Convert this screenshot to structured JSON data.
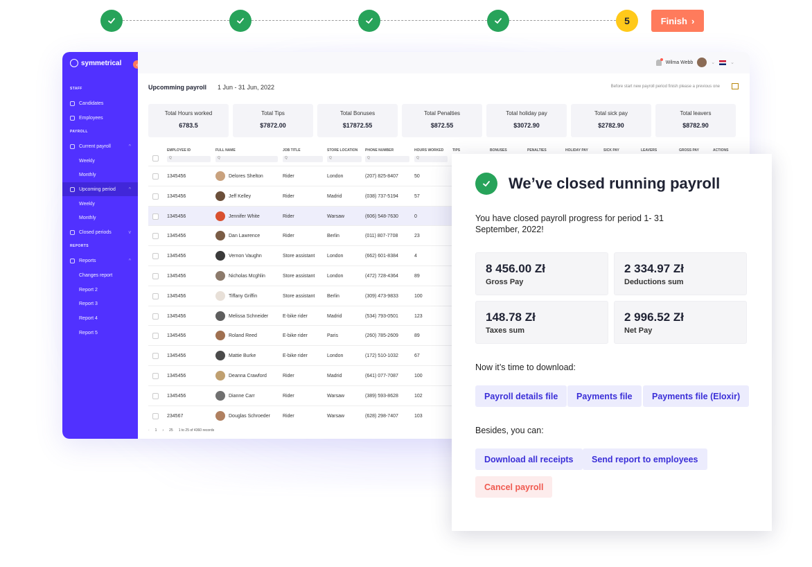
{
  "stepper": {
    "current_step": "5",
    "finish_label": "Finish",
    "done_color": "#27a35a",
    "current_color": "#ffc91a",
    "finish_color": "#ff7b5c"
  },
  "sidebar": {
    "brand": "symmetrical",
    "accent": "#5131ff",
    "sections": {
      "staff": "STAFF",
      "payroll": "PAYROLL",
      "reports": "REPORTS"
    },
    "items": {
      "candidates": "Candidates",
      "employees": "Employees",
      "current_payroll": "Current payroll",
      "current_weekly": "Weekly",
      "current_monthly": "Monthly",
      "upcoming_period": "Upcoming period",
      "upcoming_weekly": "Weekly",
      "upcoming_monthly": "Monthly",
      "closed_periods": "Closed periods",
      "reports": "Reports",
      "changes_report": "Changes report",
      "report2": "Report 2",
      "report3": "Report 3",
      "report4": "Report 4",
      "report5": "Report 5"
    }
  },
  "topbar": {
    "user_name": "Wilma Webb"
  },
  "period": {
    "title": "Upcomming payroll",
    "range": "1 Jun - 31 Jun, 2022",
    "note": "Before start new payroll period finish please a previous one"
  },
  "summary": [
    {
      "label": "Total Hours worked",
      "value": "6783.5"
    },
    {
      "label": "Total Tips",
      "value": "$7872.00"
    },
    {
      "label": "Total Bonuses",
      "value": "$17872.55"
    },
    {
      "label": "Total Penalties",
      "value": "$872.55"
    },
    {
      "label": "Total holiday pay",
      "value": "$3072.90"
    },
    {
      "label": "Total sick pay",
      "value": "$2782.90"
    },
    {
      "label": "Total leavers",
      "value": "$8782.90"
    }
  ],
  "table": {
    "headers": {
      "employee_id": "EMPLOYEE ID",
      "full_name": "FULL NAME",
      "job_title": "JOB TITLE",
      "store_location": "STORE LOCATION",
      "phone": "PHONE NUMBER",
      "hours": "HOURS WORKED",
      "tips": "TIPS",
      "bonuses": "BONUSES",
      "penalties": "PENALTIES",
      "holiday": "HOLIDAY PAY",
      "sick": "SICK PAY",
      "leavers": "LEAVERS",
      "gross": "GROSS PAY",
      "actions": "ACTIONS"
    },
    "filter_placeholder": "Q",
    "rows": [
      {
        "id": "1345456",
        "name": "Delores Shelton",
        "job": "Rider",
        "store": "London",
        "phone": "(207) 825-8407",
        "hours": "50"
      },
      {
        "id": "1345456",
        "name": "Jeff Kelley",
        "job": "Rider",
        "store": "Madrid",
        "phone": "(038) 737-5194",
        "hours": "57"
      },
      {
        "id": "1345456",
        "name": "Jennifer White",
        "job": "Rider",
        "store": "Warsaw",
        "phone": "(606) 548-7630",
        "hours": "0"
      },
      {
        "id": "1345456",
        "name": "Dan Lawrence",
        "job": "Rider",
        "store": "Berlin",
        "phone": "(011) 807-7708",
        "hours": "23"
      },
      {
        "id": "1345456",
        "name": "Vernon Vaughn",
        "job": "Store assistant",
        "store": "London",
        "phone": "(662) 601-8384",
        "hours": "4"
      },
      {
        "id": "1345456",
        "name": "Nicholas Mcghlin",
        "job": "Store assistant",
        "store": "London",
        "phone": "(472) 728-4364",
        "hours": "89"
      },
      {
        "id": "1345456",
        "name": "Tiffany Griffin",
        "job": "Store assistant",
        "store": "Berlin",
        "phone": "(309) 473-9833",
        "hours": "100"
      },
      {
        "id": "1345456",
        "name": "Melissa Schneider",
        "job": "E-bike rider",
        "store": "Madrid",
        "phone": "(534) 793-0501",
        "hours": "123"
      },
      {
        "id": "1345456",
        "name": "Roland Reed",
        "job": "E-bike rider",
        "store": "Paris",
        "phone": "(260) 785-2609",
        "hours": "89"
      },
      {
        "id": "1345456",
        "name": "Mattie Burke",
        "job": "E-bike rider",
        "store": "London",
        "phone": "(172) 510-1032",
        "hours": "67"
      },
      {
        "id": "1345456",
        "name": "Deanna Crawford",
        "job": "Rider",
        "store": "Madrid",
        "phone": "(641) 077-7087",
        "hours": "100"
      },
      {
        "id": "1345456",
        "name": "Dianne Carr",
        "job": "Rider",
        "store": "Warsaw",
        "phone": "(389) 593-8628",
        "hours": "102"
      },
      {
        "id": "234567",
        "name": "Douglas Schroeder",
        "job": "Rider",
        "store": "Warsaw",
        "phone": "(628) 298-7407",
        "hours": "103"
      }
    ],
    "pager": {
      "page": "1",
      "per_page": "25",
      "records": "1 to 25 of 4360 records"
    }
  },
  "modal": {
    "title": "We’ve closed running payroll",
    "description": "You have  closed payroll progress for period 1- 31 September, 2022!",
    "stats": [
      {
        "value": "8 456.00 Zł",
        "label": "Gross Pay"
      },
      {
        "value": "2 334.97 Zł",
        "label": "Deductions sum"
      },
      {
        "value": "148.78 Zł",
        "label": "Taxes sum"
      },
      {
        "value": "2 996.52 Zł",
        "label": "Net Pay"
      }
    ],
    "download_heading": "Now it’s time to download:",
    "download_buttons": [
      "Payroll details file",
      "Payments file",
      "Payments file (Eloxir)"
    ],
    "besides_heading": "Besides, you can:",
    "download_receipts": "Download all receipts",
    "send_report": "Send report to employees",
    "cancel_payroll": "Cancel payroll"
  }
}
